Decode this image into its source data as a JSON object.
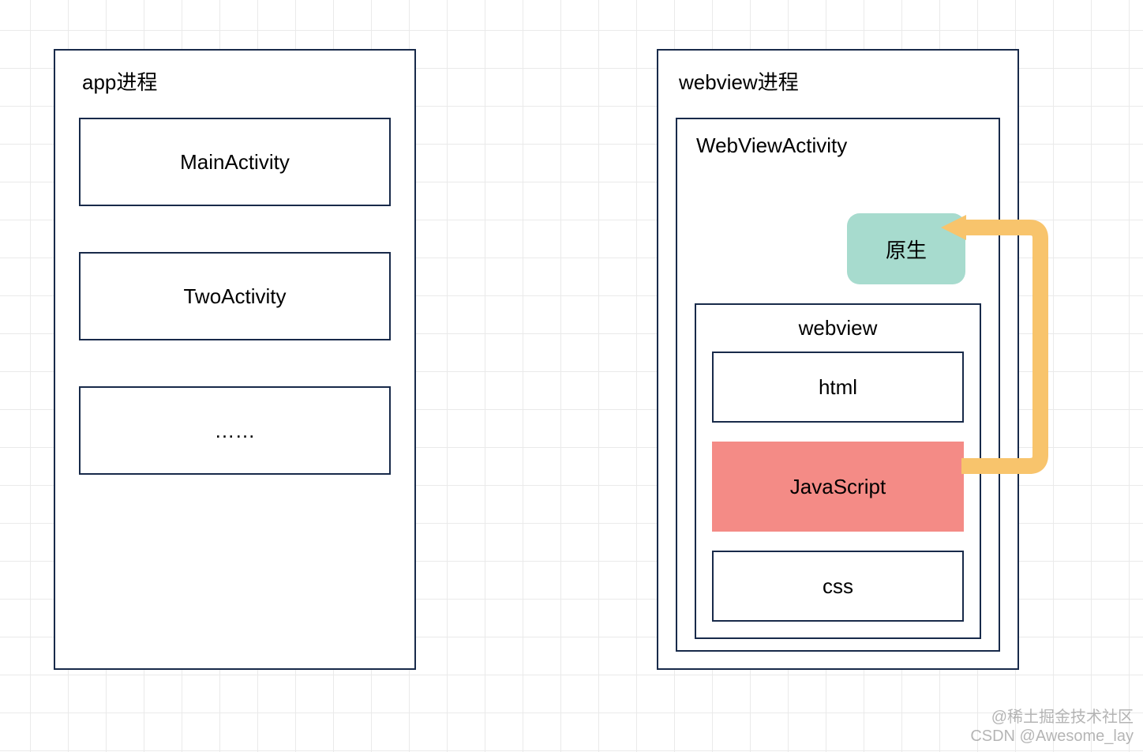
{
  "left": {
    "title": "app进程",
    "boxes": [
      "MainActivity",
      "TwoActivity",
      "……"
    ]
  },
  "right": {
    "title": "webview进程",
    "activity": {
      "title": "WebViewActivity",
      "native_label": "原生",
      "webview": {
        "title": "webview",
        "items": [
          "html",
          "JavaScript",
          "css"
        ]
      }
    }
  },
  "colors": {
    "border": "#182a4a",
    "native_bg": "#a7dbce",
    "js_bg": "#f48b86",
    "arrow": "#f8c46c"
  },
  "watermark": {
    "line1": "@稀土掘金技术社区",
    "line2": "CSDN @Awesome_lay"
  }
}
